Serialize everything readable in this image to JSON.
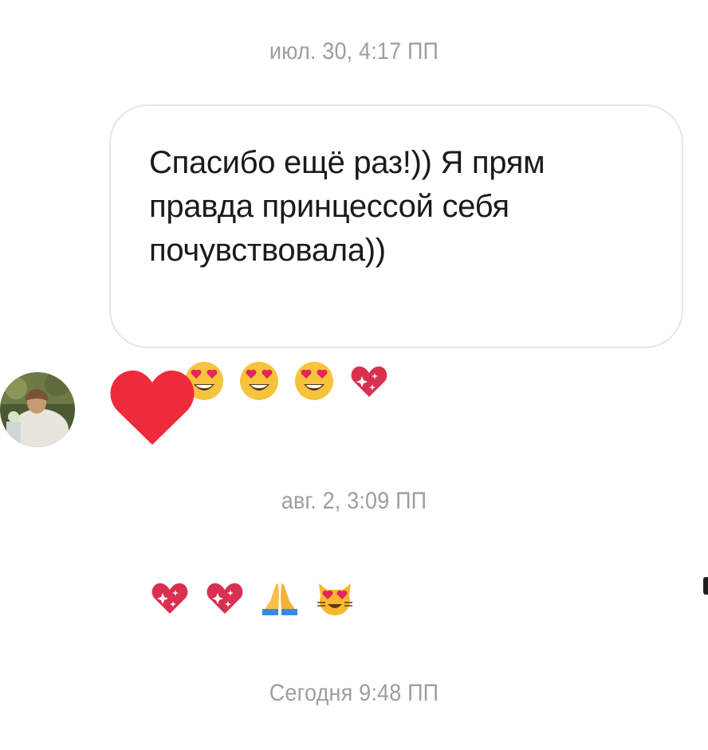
{
  "conversation": {
    "timestamps": [
      "июл. 30, 4:17 ПП",
      "авг. 2, 3:09 ПП",
      "Сегодня 9:48 ПП"
    ],
    "messages": [
      {
        "sender": "me",
        "text": "Спасибо ещё раз!)) Я прям правда принцессой себя почувствовала))",
        "emojis": [
          "heart-eyes-face",
          "heart-eyes-face",
          "heart-eyes-face",
          "sparkling-heart",
          "sparkling-heart",
          "sparkling-heart",
          "folded-hands",
          "heart-eyes-cat"
        ]
      },
      {
        "sender": "other",
        "reaction_icon": "red-heart",
        "accent": "#ee2a3d"
      }
    ]
  }
}
